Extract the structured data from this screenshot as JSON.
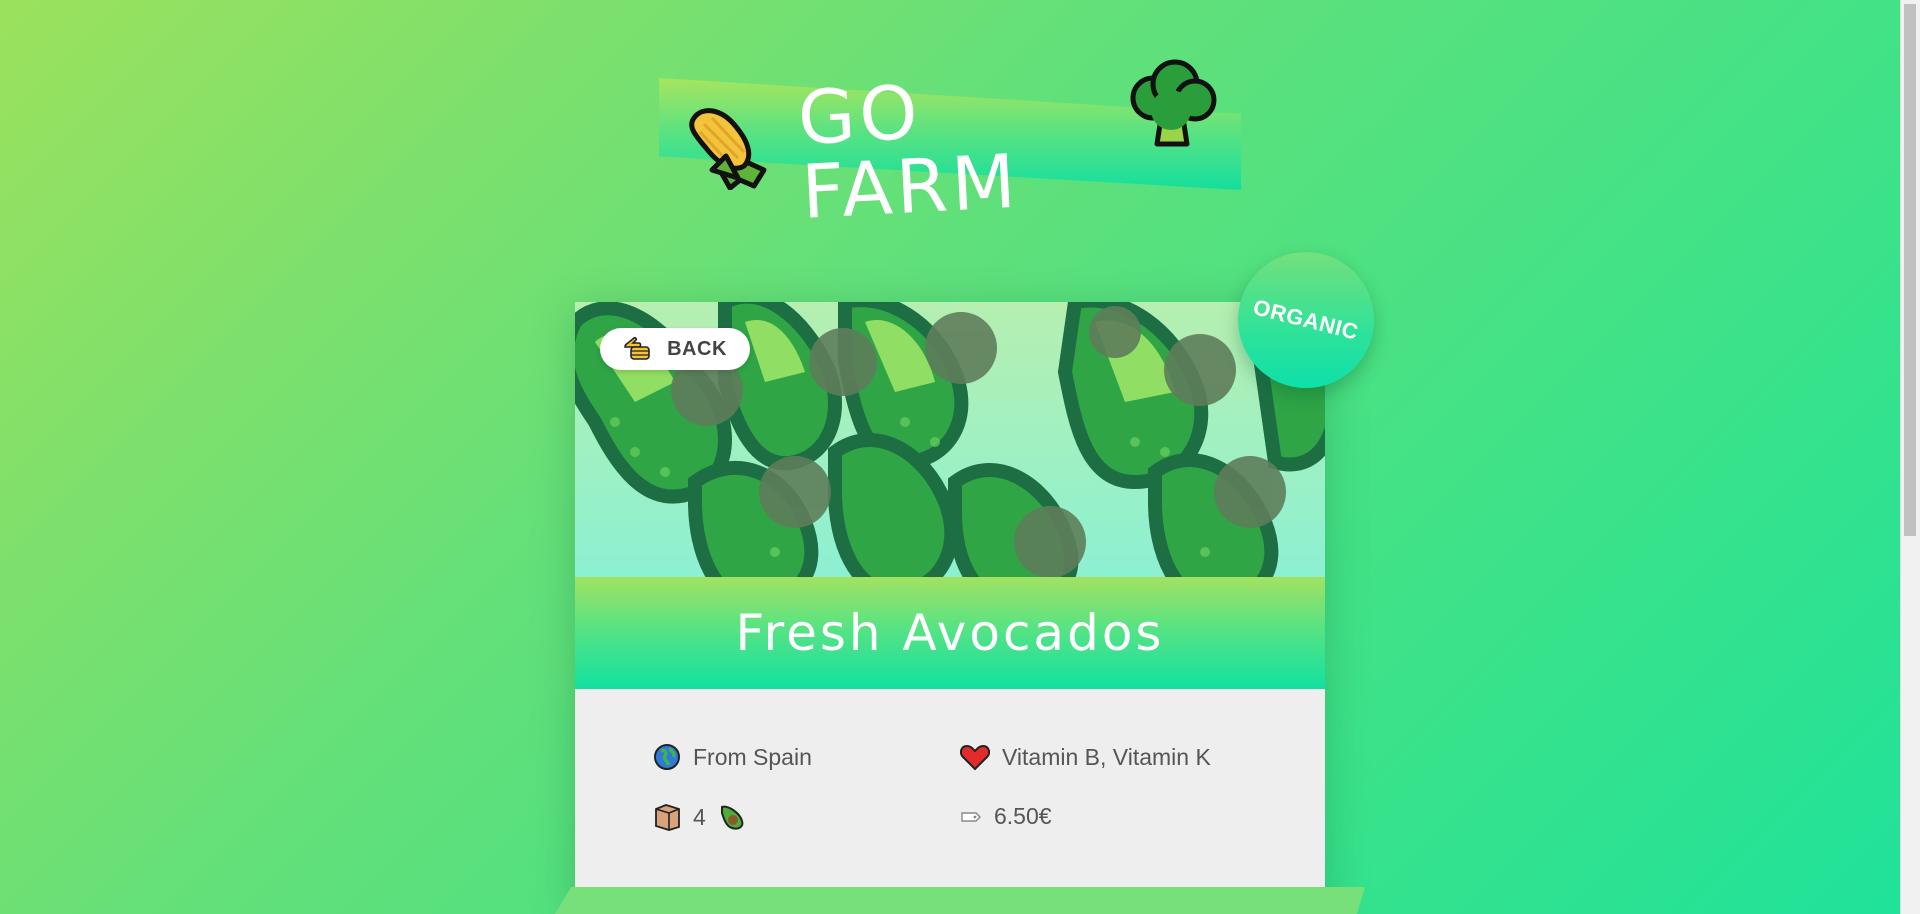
{
  "app": {
    "logo_text": "GO FARM"
  },
  "product": {
    "title": "Fresh Avocados",
    "badge": "ORGANIC",
    "back_label": "BACK",
    "origin": "From Spain",
    "nutrients": "Vitamin B, Vitamin K",
    "quantity": "4",
    "price": "6.50€"
  },
  "icons": {
    "logo_left": "corn-icon",
    "logo_right": "broccoli-icon",
    "back": "pointing-hand-icon",
    "origin": "globe-icon",
    "nutrients": "heart-icon",
    "quantity": "box-icon",
    "quantity_unit": "avocado-icon",
    "price": "price-tag-icon"
  },
  "colors": {
    "bg_start": "#9be15d",
    "bg_end": "#1fe29a",
    "card_body": "#eeeeee",
    "text": "#555555"
  }
}
